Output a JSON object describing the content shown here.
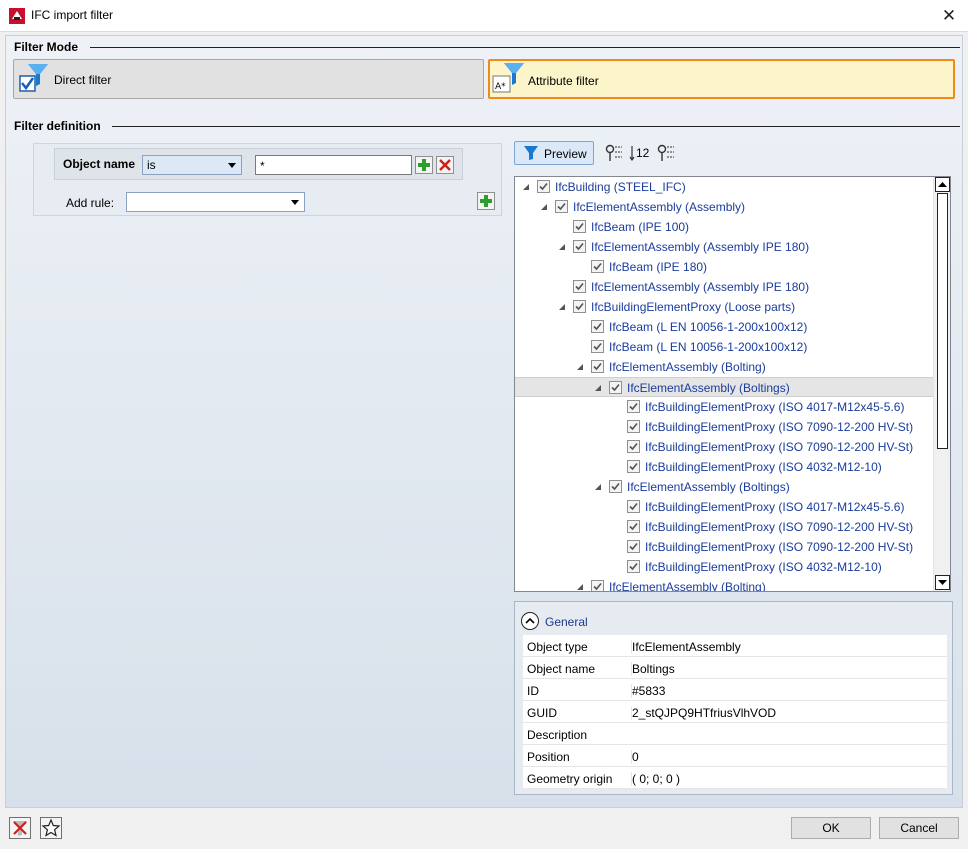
{
  "window": {
    "title": "IFC import filter",
    "close_glyph": "✕"
  },
  "filter_mode": {
    "title": "Filter Mode",
    "direct_label": "Direct filter",
    "attribute_label": "Attribute filter"
  },
  "filter_definition": {
    "title": "Filter definition",
    "object_name_label": "Object name",
    "operator_value": "is",
    "value_text": "*",
    "add_rule_label": "Add rule:",
    "add_rule_value": ""
  },
  "toolbar": {
    "preview_label": "Preview",
    "sort_numeric_label": "12"
  },
  "tree": {
    "rows": [
      {
        "label": "IfcBuilding (STEEL_IFC)",
        "level": 0,
        "expander": true,
        "selected": false
      },
      {
        "label": "IfcElementAssembly (Assembly)",
        "level": 1,
        "expander": true,
        "selected": false
      },
      {
        "label": "IfcBeam (IPE 100)",
        "level": 2,
        "expander": false,
        "selected": false
      },
      {
        "label": "IfcElementAssembly (Assembly IPE 180)",
        "level": 2,
        "expander": true,
        "selected": false
      },
      {
        "label": "IfcBeam (IPE 180)",
        "level": 3,
        "expander": false,
        "selected": false
      },
      {
        "label": "IfcElementAssembly (Assembly IPE 180)",
        "level": 2,
        "expander": false,
        "selected": false
      },
      {
        "label": "IfcBuildingElementProxy (Loose parts)",
        "level": 2,
        "expander": true,
        "selected": false
      },
      {
        "label": "IfcBeam (L EN 10056-1-200x100x12)",
        "level": 3,
        "expander": false,
        "selected": false
      },
      {
        "label": "IfcBeam (L EN 10056-1-200x100x12)",
        "level": 3,
        "expander": false,
        "selected": false
      },
      {
        "label": "IfcElementAssembly (Bolting)",
        "level": 3,
        "expander": true,
        "selected": false
      },
      {
        "label": "IfcElementAssembly (Boltings)",
        "level": 4,
        "expander": true,
        "selected": true
      },
      {
        "label": "IfcBuildingElementProxy (ISO 4017-M12x45-5.6)",
        "level": 5,
        "expander": false,
        "selected": false
      },
      {
        "label": "IfcBuildingElementProxy (ISO 7090-12-200 HV-St)",
        "level": 5,
        "expander": false,
        "selected": false
      },
      {
        "label": "IfcBuildingElementProxy (ISO 7090-12-200 HV-St)",
        "level": 5,
        "expander": false,
        "selected": false
      },
      {
        "label": "IfcBuildingElementProxy (ISO 4032-M12-10)",
        "level": 5,
        "expander": false,
        "selected": false
      },
      {
        "label": "IfcElementAssembly (Boltings)",
        "level": 4,
        "expander": true,
        "selected": false
      },
      {
        "label": "IfcBuildingElementProxy (ISO 4017-M12x45-5.6)",
        "level": 5,
        "expander": false,
        "selected": false
      },
      {
        "label": "IfcBuildingElementProxy (ISO 7090-12-200 HV-St)",
        "level": 5,
        "expander": false,
        "selected": false
      },
      {
        "label": "IfcBuildingElementProxy (ISO 7090-12-200 HV-St)",
        "level": 5,
        "expander": false,
        "selected": false
      },
      {
        "label": "IfcBuildingElementProxy (ISO 4032-M12-10)",
        "level": 5,
        "expander": false,
        "selected": false
      },
      {
        "label": "IfcElementAssembly (Bolting)",
        "level": 3,
        "expander": true,
        "selected": false
      }
    ]
  },
  "properties": {
    "group_label": "General",
    "rows": [
      {
        "key": "Object type",
        "value": "IfcElementAssembly"
      },
      {
        "key": "Object name",
        "value": "Boltings"
      },
      {
        "key": "ID",
        "value": "#5833"
      },
      {
        "key": "GUID",
        "value": "2_stQJPQ9HTfriusVlhVOD"
      },
      {
        "key": "Description",
        "value": ""
      },
      {
        "key": "Position",
        "value": "0"
      },
      {
        "key": "Geometry origin",
        "value": "( 0; 0; 0 )"
      }
    ]
  },
  "footer": {
    "ok_label": "OK",
    "cancel_label": "Cancel"
  },
  "colors": {
    "accent_orange": "#f08a1c",
    "active_fill": "#fcf5c9",
    "tree_text": "#1a3c9c"
  }
}
